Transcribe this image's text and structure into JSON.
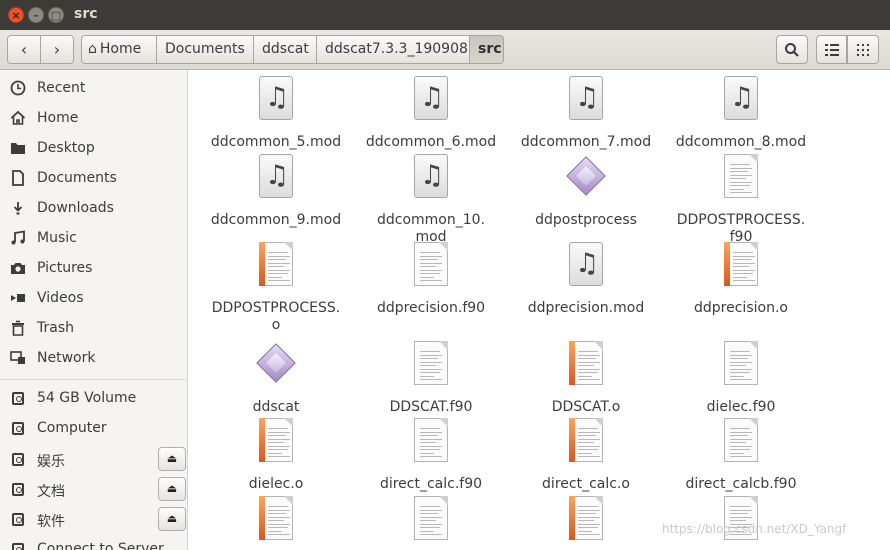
{
  "window": {
    "title": "src"
  },
  "toolbar": {
    "breadcrumbs": [
      {
        "label": "Home",
        "icon": "home-icon"
      },
      {
        "label": "Documents"
      },
      {
        "label": "ddscat"
      },
      {
        "label": "ddscat7.3.3_190908"
      },
      {
        "label": "src"
      }
    ]
  },
  "sidebar": {
    "places": [
      {
        "label": "Recent",
        "icon": "clock-icon"
      },
      {
        "label": "Home",
        "icon": "home-icon"
      },
      {
        "label": "Desktop",
        "icon": "folder-icon"
      },
      {
        "label": "Documents",
        "icon": "document-icon"
      },
      {
        "label": "Downloads",
        "icon": "download-icon"
      },
      {
        "label": "Music",
        "icon": "music-icon"
      },
      {
        "label": "Pictures",
        "icon": "camera-icon"
      },
      {
        "label": "Videos",
        "icon": "video-icon"
      },
      {
        "label": "Trash",
        "icon": "trash-icon"
      },
      {
        "label": "Network",
        "icon": "network-icon"
      }
    ],
    "devices": [
      {
        "label": "54 GB Volume",
        "eject": false
      },
      {
        "label": "Computer",
        "eject": false
      },
      {
        "label": "娱乐",
        "eject": true
      },
      {
        "label": "文档",
        "eject": true
      },
      {
        "label": "软件",
        "eject": true
      },
      {
        "label": "Connect to Server",
        "eject": false
      }
    ]
  },
  "files": [
    {
      "name": "ddcommon_5.mod",
      "type": "audio"
    },
    {
      "name": "ddcommon_6.mod",
      "type": "audio"
    },
    {
      "name": "ddcommon_7.mod",
      "type": "audio"
    },
    {
      "name": "ddcommon_8.mod",
      "type": "audio"
    },
    {
      "name": "ddcommon_9.mod",
      "type": "audio"
    },
    {
      "name": "ddcommon_10.\nmod",
      "type": "audio"
    },
    {
      "name": "ddpostprocess",
      "type": "exec"
    },
    {
      "name": "DDPOSTPROCESS.\nf90",
      "type": "text"
    },
    {
      "name": "DDPOSTPROCESS.\no",
      "type": "object"
    },
    {
      "name": "ddprecision.f90",
      "type": "text"
    },
    {
      "name": "ddprecision.mod",
      "type": "audio"
    },
    {
      "name": "ddprecision.o",
      "type": "object"
    },
    {
      "name": "ddscat",
      "type": "exec"
    },
    {
      "name": "DDSCAT.f90",
      "type": "text"
    },
    {
      "name": "DDSCAT.o",
      "type": "object"
    },
    {
      "name": "dielec.f90",
      "type": "text"
    },
    {
      "name": "dielec.o",
      "type": "object"
    },
    {
      "name": "direct_calc.f90",
      "type": "text"
    },
    {
      "name": "direct_calc.o",
      "type": "object"
    },
    {
      "name": "direct_calcb.f90",
      "type": "text"
    },
    {
      "name": "",
      "type": "object"
    },
    {
      "name": "",
      "type": "text"
    },
    {
      "name": "",
      "type": "object"
    },
    {
      "name": "",
      "type": "text"
    }
  ],
  "watermark": "https://blog.csdn.net/XD_Yangf"
}
